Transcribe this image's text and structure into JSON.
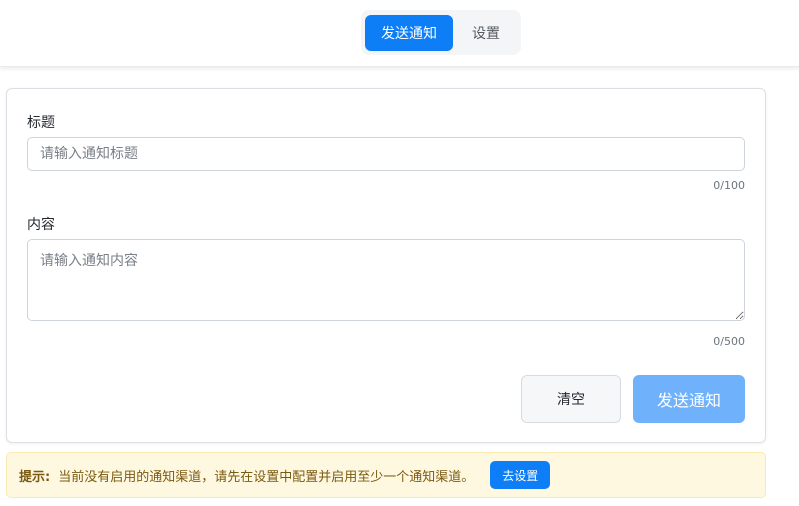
{
  "header": {
    "tabs": [
      {
        "label": "发送通知",
        "active": true
      },
      {
        "label": "设置",
        "active": false
      }
    ]
  },
  "form": {
    "title_label": "标题",
    "title_placeholder": "请输入通知标题",
    "title_value": "",
    "title_counter": "0/100",
    "content_label": "内容",
    "content_placeholder": "请输入通知内容",
    "content_value": "",
    "content_counter": "0/500",
    "clear_label": "清空",
    "send_label": "发送通知"
  },
  "alert": {
    "prefix": "提示:",
    "message": "当前没有启用的通知渠道，请先在设置中配置并启用至少一个通知渠道。",
    "button_label": "去设置"
  },
  "colors": {
    "accent": "#0d7ef6",
    "accent_disabled": "#6fb1fb",
    "alert_background": "#fff8e1",
    "alert_text": "#7a5a10"
  }
}
